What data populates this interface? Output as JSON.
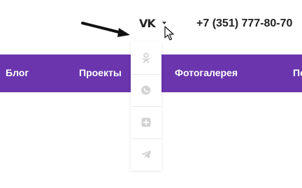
{
  "header": {
    "social_icon": "vk-icon",
    "social_icon_text": "VK",
    "dropdown_indicator": "caret-down-icon",
    "phone": "+7 (351) 777-80-70"
  },
  "nav": {
    "items": [
      {
        "label": "Блог"
      },
      {
        "label": "Проекты"
      },
      {
        "label": "Фотогалерея"
      },
      {
        "label": "По"
      }
    ],
    "background": "#6a35ad"
  },
  "social_dropdown": {
    "items": [
      {
        "icon": "odnoklassniki-icon"
      },
      {
        "icon": "whatsapp-icon"
      },
      {
        "icon": "plus-square-icon"
      },
      {
        "icon": "telegram-icon"
      }
    ],
    "icon_color": "#d3d3d3"
  }
}
